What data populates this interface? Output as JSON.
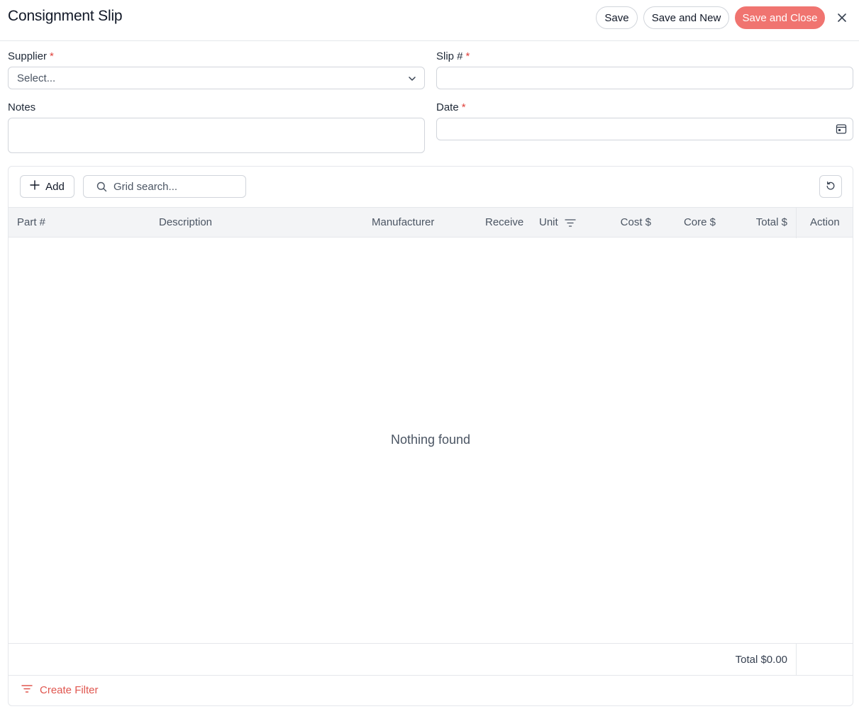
{
  "header": {
    "title": "Consignment Slip",
    "save_label": "Save",
    "save_new_label": "Save and New",
    "save_close_label": "Save and Close"
  },
  "form": {
    "supplier": {
      "label": "Supplier",
      "required_mark": "*",
      "placeholder": "Select..."
    },
    "slip": {
      "label": "Slip #",
      "required_mark": "*",
      "value": ""
    },
    "notes": {
      "label": "Notes",
      "value": ""
    },
    "date": {
      "label": "Date",
      "required_mark": "*",
      "value": ""
    }
  },
  "grid": {
    "add_label": "Add",
    "search_placeholder": "Grid search...",
    "columns": [
      "Part #",
      "Description",
      "Manufacturer",
      "Receive",
      "Unit",
      "Cost $",
      "Core $",
      "Total $",
      "Action"
    ],
    "empty_text": "Nothing found",
    "total_text": "Total $0.00",
    "create_filter_label": "Create Filter"
  },
  "colors": {
    "accent": "#f07470",
    "required": "#e0433d",
    "link": "#e0564f"
  },
  "icons": [
    "close-icon",
    "chevron-down-icon",
    "calendar-icon",
    "plus-icon",
    "search-icon",
    "reset-icon",
    "filter-icon"
  ]
}
